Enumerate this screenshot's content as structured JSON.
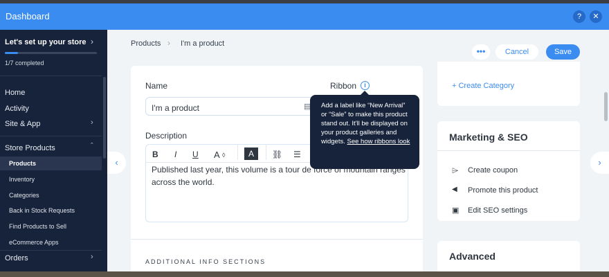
{
  "header": {
    "title": "Dashboard",
    "help_icon": "?",
    "close_icon": "✕"
  },
  "sidebar": {
    "setup_title": "Let's set up your store",
    "progress": {
      "fraction": 0.14,
      "text": "1/7 completed"
    },
    "nav": {
      "home": "Home",
      "activity": "Activity",
      "site_app": "Site & App",
      "store_products": "Store Products",
      "orders": "Orders"
    },
    "store_items": [
      "Products",
      "Inventory",
      "Categories",
      "Back in Stock Requests",
      "Find Products to Sell",
      "eCommerce Apps"
    ]
  },
  "breadcrumb": {
    "products": "Products",
    "current": "I'm a product"
  },
  "actions": {
    "more": "•••",
    "cancel": "Cancel",
    "save": "Save"
  },
  "form": {
    "name_label": "Name",
    "name_value": "I'm a product",
    "ribbon_label": "Ribbon",
    "description_label": "Description",
    "description_text": "Published last year, this volume is a tour de force of mountain ranges across the world.",
    "additional_sections": "ADDITIONAL INFO SECTIONS"
  },
  "toolbar": {
    "bold": "B",
    "italic": "I",
    "underline": "U"
  },
  "tooltip": {
    "text": "Add a label like “New Arrival” or “Sale” to make this product stand out. It'll be displayed on your product galleries and widgets.",
    "link": "See how ribbons look"
  },
  "right": {
    "create_category": "+ Create Category",
    "marketing": {
      "title": "Marketing & SEO",
      "items": [
        {
          "icon": "coupon-icon",
          "label": "Create coupon"
        },
        {
          "icon": "megaphone-icon",
          "label": "Promote this product"
        },
        {
          "icon": "seo-icon",
          "label": "Edit SEO settings"
        }
      ]
    },
    "advanced_title": "Advanced"
  },
  "colors": {
    "accent": "#3b8cf0",
    "sidebar": "#17233a",
    "tooltip": "#17233a"
  }
}
